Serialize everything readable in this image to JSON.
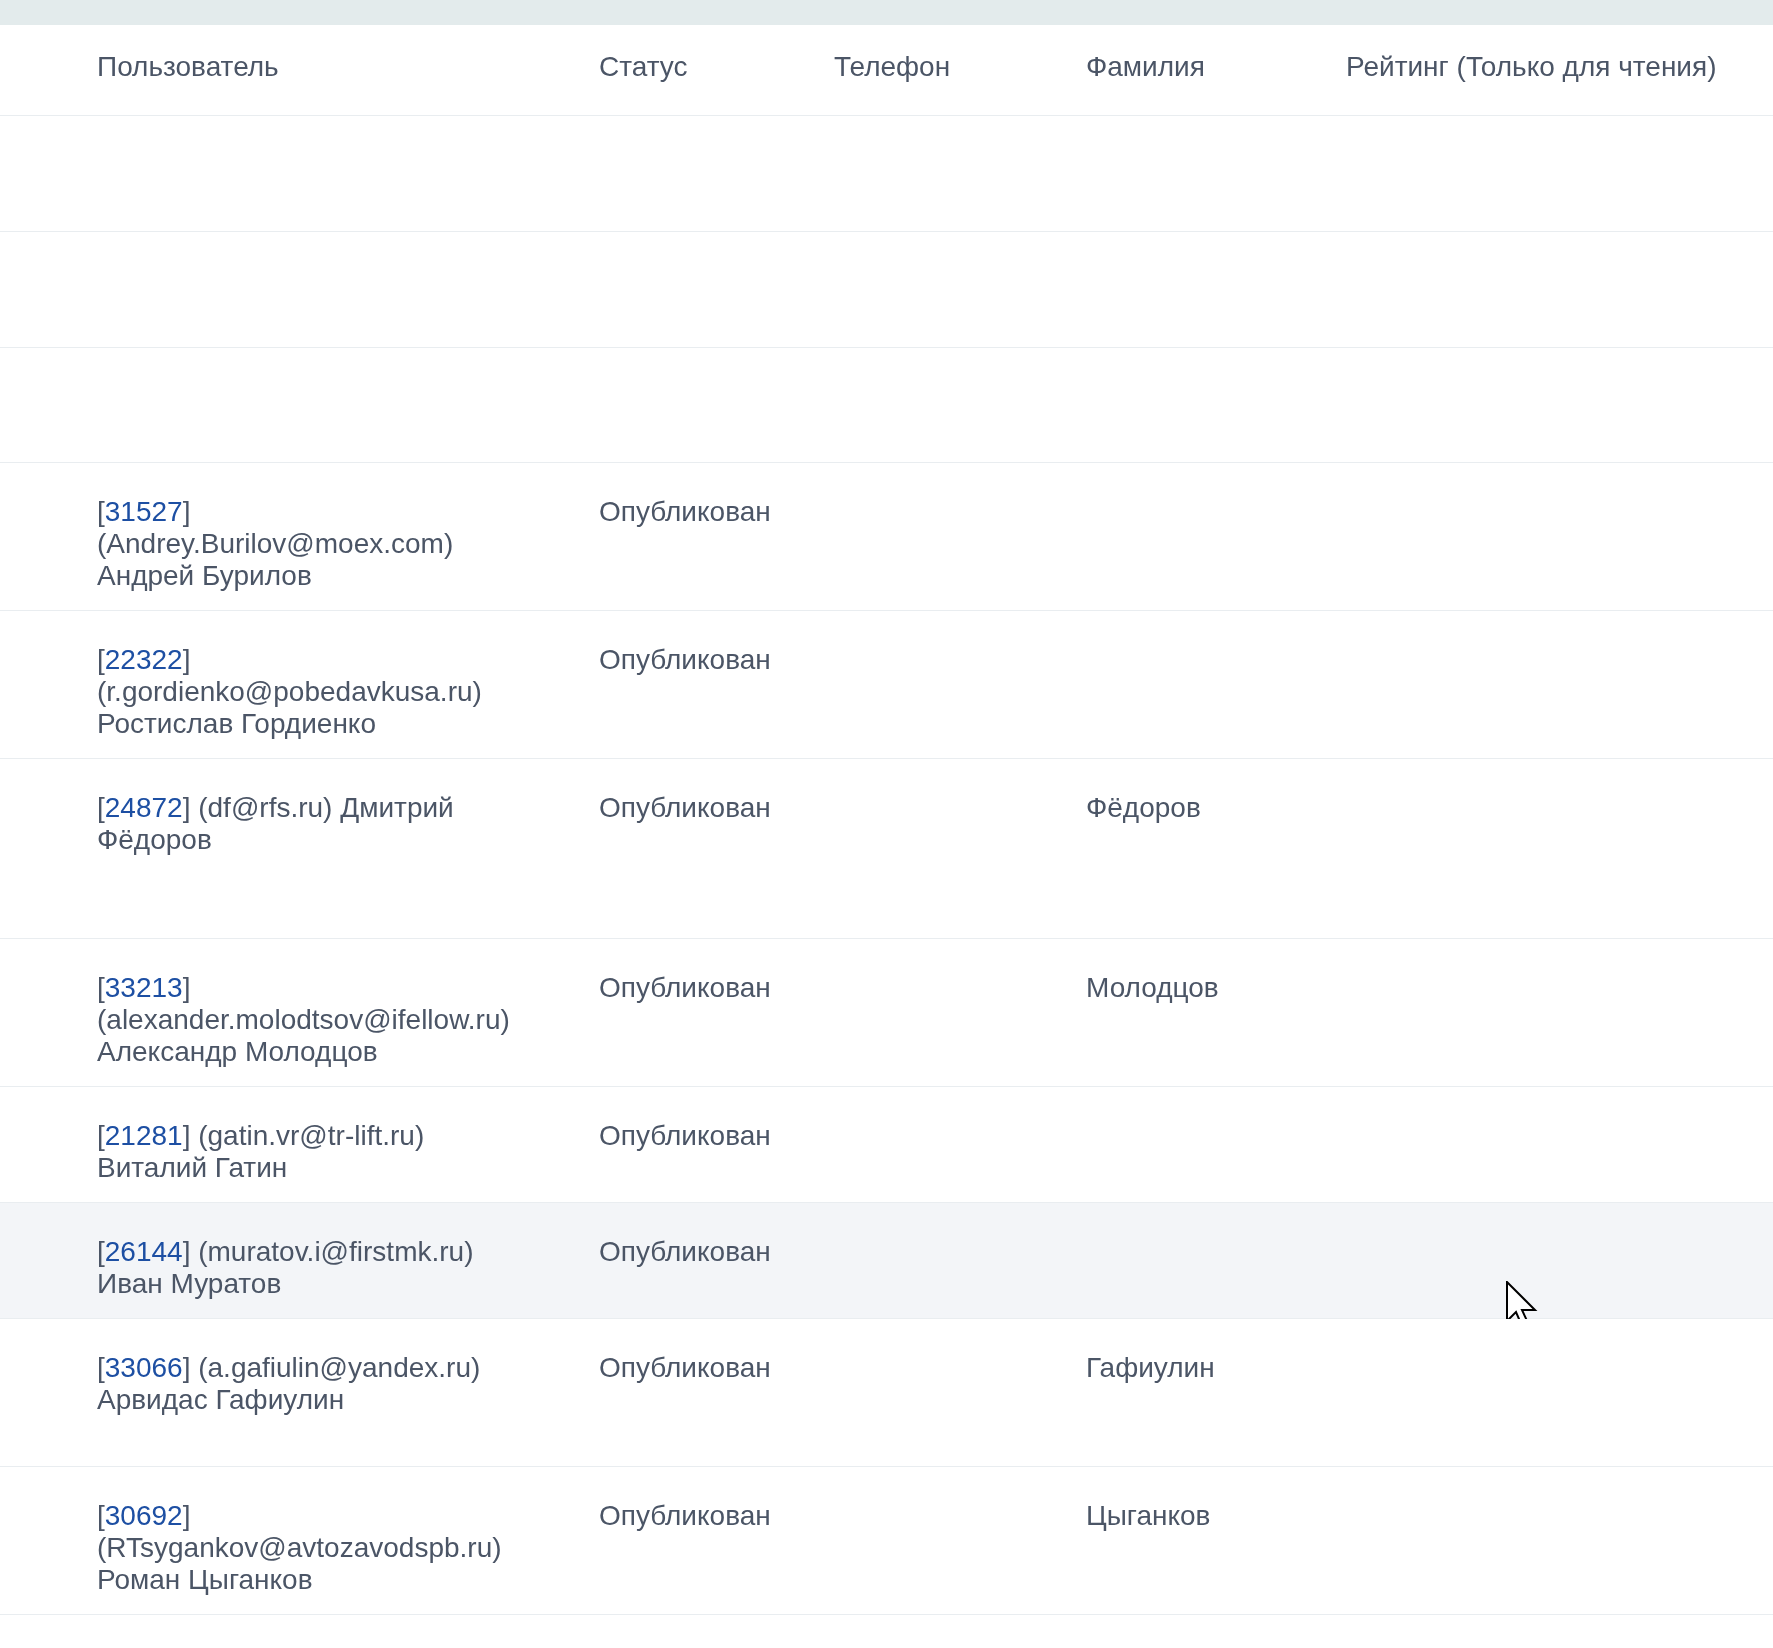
{
  "table": {
    "columns": [
      "Пользователь",
      "Статус",
      "Телефон",
      "Фамилия",
      "Рейтинг (Только для чтения)"
    ],
    "rows": [
      {
        "hovered": false
      },
      {
        "hovered": false
      },
      {
        "hovered": false
      },
      {
        "hovered": false,
        "user": {
          "prefix": "[",
          "id": "31527",
          "suffix": "] (Andrey.Burilov@moex.com) Андрей Бурилов"
        },
        "status": "Опубликован"
      },
      {
        "hovered": false,
        "user": {
          "prefix": "[",
          "id": "22322",
          "suffix": "] (r.gordienko@pobedavkusa.ru) Ростислав Гордиенко"
        },
        "status": "Опубликован"
      },
      {
        "hovered": false,
        "user": {
          "prefix": "[",
          "id": "24872",
          "suffix": "] (df@rfs.ru) Дмитрий Фёдоров"
        },
        "status": "Опубликован",
        "surname": "Фёдоров"
      },
      {
        "hovered": false,
        "user": {
          "prefix": "[",
          "id": "33213",
          "suffix": "] (alexander.molodtsov@ifellow.ru) Александр Молодцов"
        },
        "status": "Опубликован",
        "surname": "Молодцов"
      },
      {
        "hovered": false,
        "user": {
          "prefix": "[",
          "id": "21281",
          "suffix": "] (gatin.vr@tr-lift.ru) Виталий Гатин"
        },
        "status": "Опубликован"
      },
      {
        "hovered": true,
        "user": {
          "prefix": "[",
          "id": "26144",
          "suffix": "] (muratov.i@firstmk.ru) Иван Муратов"
        },
        "status": "Опубликован"
      },
      {
        "hovered": false,
        "user": {
          "prefix": "[",
          "id": "33066",
          "suffix": "] (a.gafiulin@yandex.ru) Арвидас Гафиулин"
        },
        "status": "Опубликован",
        "surname": "Гафиулин"
      },
      {
        "hovered": false,
        "user": {
          "prefix": "[",
          "id": "30692",
          "suffix": "] (RTsygankov@avtozavodspb.ru) Роман Цыганков"
        },
        "status": "Опубликован",
        "surname": "Цыганков"
      }
    ]
  }
}
